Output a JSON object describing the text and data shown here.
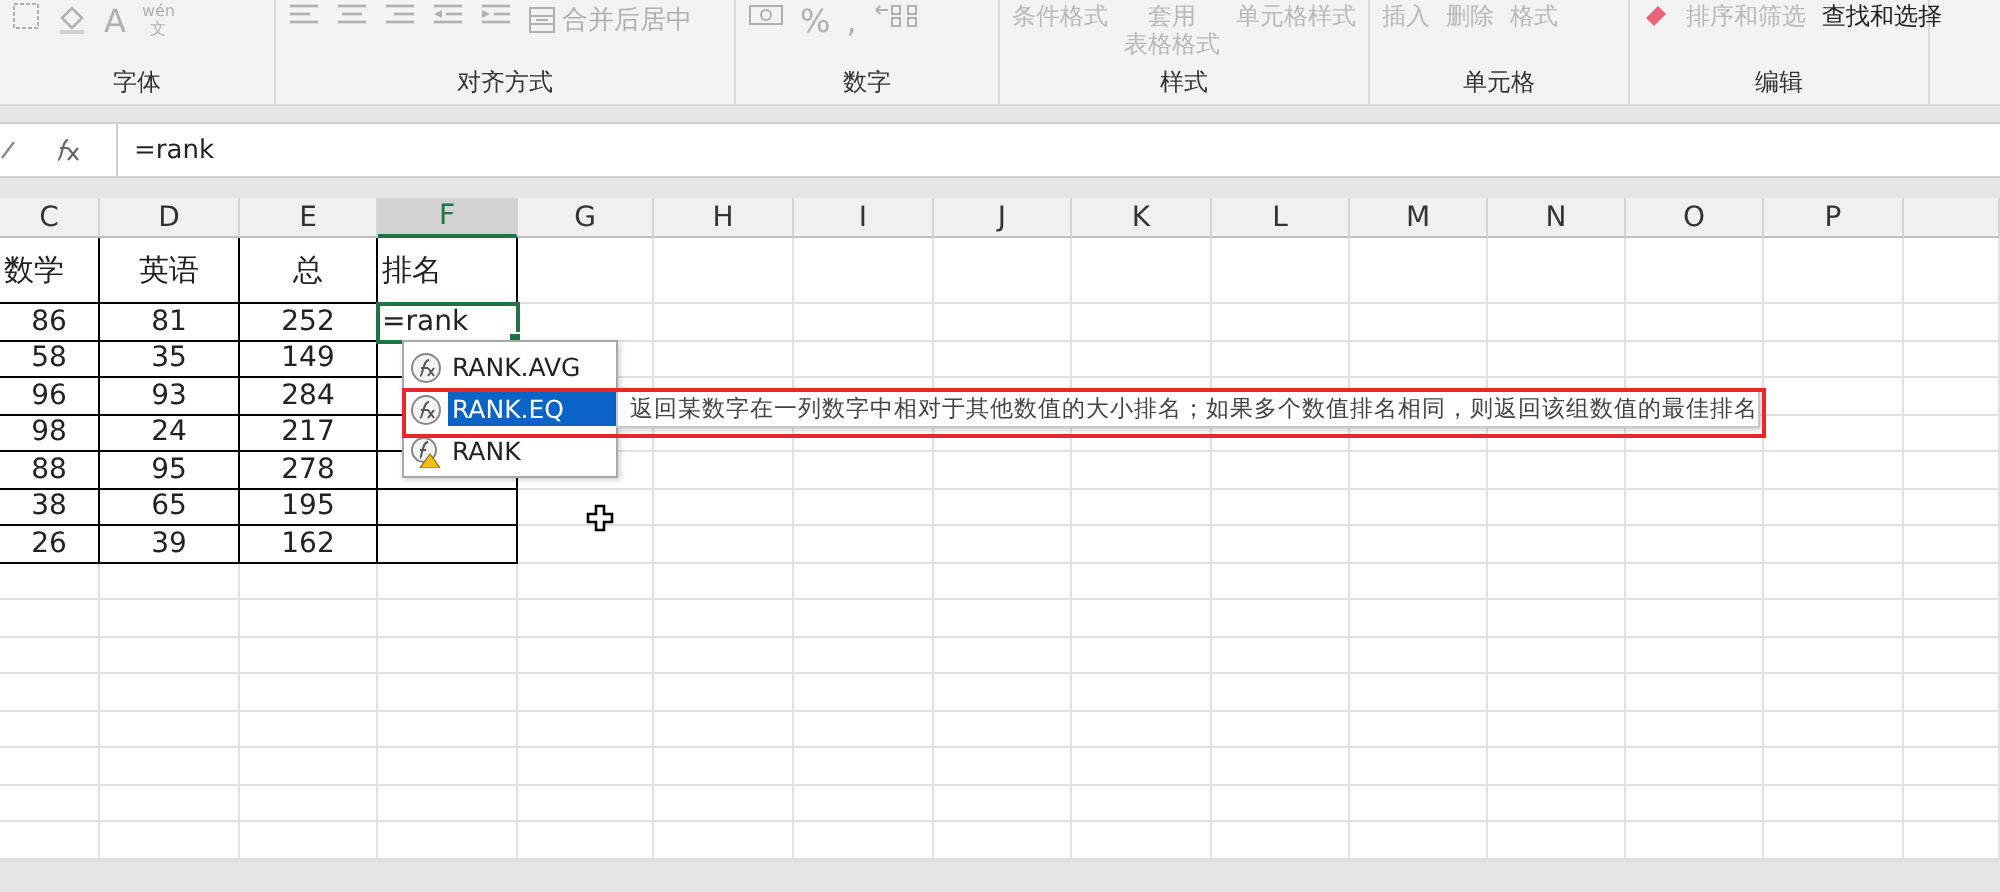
{
  "ribbon": {
    "groups": [
      {
        "label": "字体",
        "buttons": [
          {
            "kind": "borders",
            "disabled": true
          },
          {
            "kind": "fill",
            "disabled": true
          },
          {
            "kind": "font-color",
            "label": "A",
            "disabled": true
          },
          {
            "kind": "phonetic",
            "label": "wén",
            "sub": "文",
            "disabled": true
          }
        ]
      },
      {
        "label": "对齐方式",
        "buttons": [
          {
            "kind": "align-left",
            "disabled": true
          },
          {
            "kind": "align-center",
            "disabled": true
          },
          {
            "kind": "align-right",
            "disabled": true
          },
          {
            "kind": "outdent",
            "disabled": true
          },
          {
            "kind": "indent",
            "disabled": true
          },
          {
            "kind": "merge",
            "label": "合并后居中",
            "disabled": true
          }
        ]
      },
      {
        "label": "数字",
        "buttons": [
          {
            "kind": "currency",
            "disabled": true
          },
          {
            "kind": "symbol",
            "label": "%",
            "disabled": true
          },
          {
            "kind": "symbol",
            "label": ",",
            "disabled": true
          },
          {
            "kind": "decimal",
            "disabled": true
          }
        ]
      },
      {
        "label": "样式",
        "buttons": [
          {
            "kind": "big",
            "label": "条件格式",
            "disabled": true
          },
          {
            "kind": "big",
            "label": "套用",
            "sub": "表格格式",
            "disabled": true
          },
          {
            "kind": "big",
            "label": "单元格样式",
            "disabled": true
          }
        ]
      },
      {
        "label": "单元格",
        "buttons": [
          {
            "kind": "big",
            "label": "插入",
            "disabled": true
          },
          {
            "kind": "big",
            "label": "删除",
            "disabled": true
          },
          {
            "kind": "big",
            "label": "格式",
            "disabled": true
          }
        ]
      },
      {
        "label": "编辑",
        "buttons": [
          {
            "kind": "eraser",
            "disabled": false
          },
          {
            "kind": "big",
            "label": "排序和筛选",
            "disabled": true
          },
          {
            "kind": "big",
            "label": "查找和选择",
            "disabled": false
          }
        ]
      }
    ]
  },
  "formula_bar": {
    "value": "=rank"
  },
  "sheet": {
    "columns": [
      {
        "label": "C",
        "selected": false
      },
      {
        "label": "D",
        "selected": false
      },
      {
        "label": "E",
        "selected": false
      },
      {
        "label": "F",
        "selected": true
      },
      {
        "label": "G",
        "selected": false
      },
      {
        "label": "H",
        "selected": false
      },
      {
        "label": "I",
        "selected": false
      },
      {
        "label": "J",
        "selected": false
      },
      {
        "label": "K",
        "selected": false
      },
      {
        "label": "L",
        "selected": false
      },
      {
        "label": "M",
        "selected": false
      },
      {
        "label": "N",
        "selected": false
      },
      {
        "label": "O",
        "selected": false
      },
      {
        "label": "P",
        "selected": false
      }
    ],
    "rows": [
      {
        "cells": [
          {
            "text": "数学",
            "selected": false
          },
          {
            "text": "英语",
            "selected": false
          },
          {
            "text": "总",
            "selected": false
          },
          {
            "text": "排名",
            "selected": false
          }
        ]
      },
      {
        "cells": [
          {
            "text": "86",
            "selected": false
          },
          {
            "text": "81",
            "selected": false
          },
          {
            "text": "252",
            "selected": false
          },
          {
            "text": "=rank",
            "selected": true
          }
        ]
      },
      {
        "cells": [
          {
            "text": "58",
            "selected": false
          },
          {
            "text": "35",
            "selected": false
          },
          {
            "text": "149",
            "selected": false
          },
          {
            "selected": false
          }
        ]
      },
      {
        "cells": [
          {
            "text": "96",
            "selected": false
          },
          {
            "text": "93",
            "selected": false
          },
          {
            "text": "284",
            "selected": false
          },
          {
            "selected": false
          }
        ]
      },
      {
        "cells": [
          {
            "text": "98",
            "selected": false
          },
          {
            "text": "24",
            "selected": false
          },
          {
            "text": "217",
            "selected": false
          },
          {
            "selected": false
          }
        ]
      },
      {
        "cells": [
          {
            "text": "88",
            "selected": false
          },
          {
            "text": "95",
            "selected": false
          },
          {
            "text": "278",
            "selected": false
          },
          {
            "selected": false
          }
        ]
      },
      {
        "cells": [
          {
            "text": "38",
            "selected": false
          },
          {
            "text": "65",
            "selected": false
          },
          {
            "text": "195",
            "selected": false
          },
          {
            "selected": false
          }
        ]
      },
      {
        "cells": [
          {
            "text": "26",
            "selected": false
          },
          {
            "text": "39",
            "selected": false
          },
          {
            "text": "162",
            "selected": false
          },
          {
            "selected": false
          }
        ]
      }
    ]
  },
  "autocomplete": {
    "items": [
      {
        "label": "RANK.AVG",
        "kind": "function",
        "selected": false
      },
      {
        "label": "RANK.EQ",
        "kind": "function",
        "selected": true
      },
      {
        "label": "RANK",
        "kind": "compat",
        "selected": false
      }
    ]
  },
  "tooltip": {
    "text": "返回某数字在一列数字中相对于其他数值的大小排名；如果多个数值排名相同，则返回该组数值的最佳排名"
  }
}
